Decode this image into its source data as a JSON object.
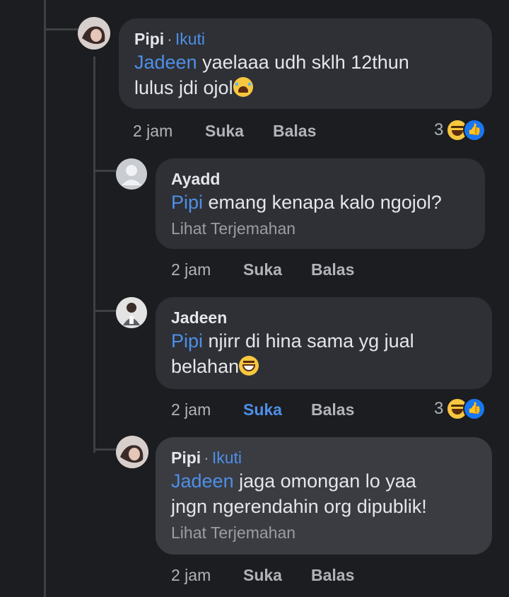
{
  "comments": [
    {
      "author": "Pipi",
      "separator": "·",
      "follow_label": "Ikuti",
      "mention": "Jadeen",
      "text_line1": " yaelaaa udh sklh 12thun",
      "text_line2": "lulus jdi ojol",
      "emoji": "crying-face",
      "time": "2 jam",
      "like_label": "Suka",
      "reply_label": "Balas",
      "reaction_count": "3",
      "reactions": [
        "haha-icon",
        "like-icon"
      ]
    },
    {
      "author": "Ayadd",
      "mention": "Pipi",
      "text_line1": " emang kenapa kalo ngojol?",
      "translate_label": "Lihat Terjemahan",
      "time": "2 jam",
      "like_label": "Suka",
      "reply_label": "Balas"
    },
    {
      "author": "Jadeen",
      "mention": "Pipi",
      "text_line1": " njirr di hina sama yg jual",
      "text_line2": "belahan",
      "emoji": "grinning-face",
      "time": "2 jam",
      "like_label": "Suka",
      "like_active_color": "#4e8fe8",
      "reply_label": "Balas",
      "reaction_count": "3",
      "reactions": [
        "haha-icon",
        "like-icon"
      ]
    },
    {
      "author": "Pipi",
      "separator": "·",
      "follow_label": "Ikuti",
      "mention": "Jadeen",
      "text_line1": " jaga omongan lo yaa",
      "text_line2": "jngn ngerendahin org dipublik!",
      "translate_label": "Lihat Terjemahan",
      "time": "2 jam",
      "like_label": "Suka",
      "reply_label": "Balas"
    }
  ],
  "colors": {
    "background": "#1c1d21",
    "bubble": "#2e3035",
    "link": "#4e8fe8",
    "muted": "#b0b3b8"
  }
}
